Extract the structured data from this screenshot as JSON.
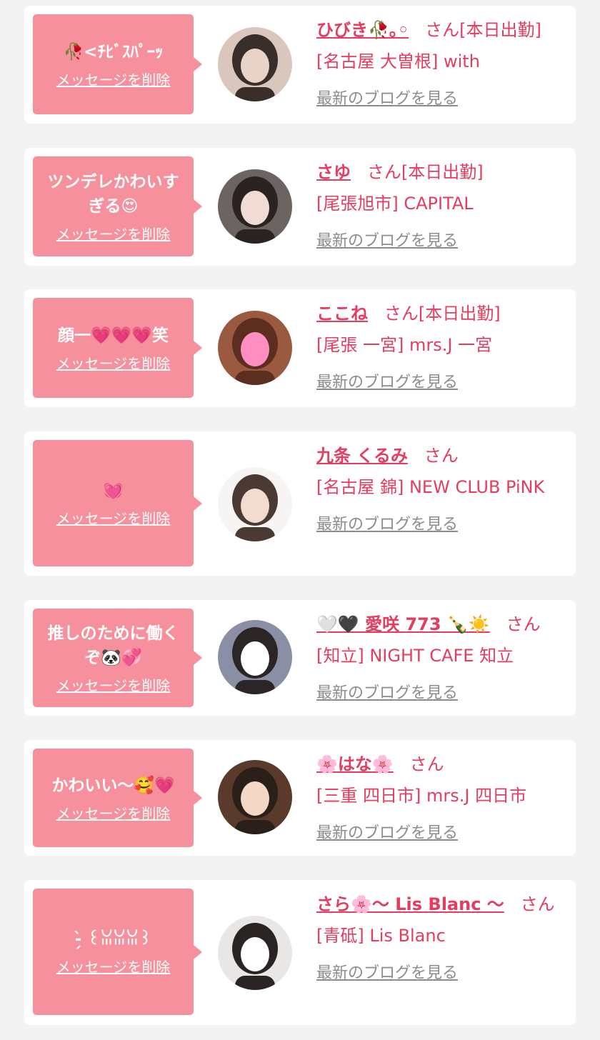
{
  "cards": [
    {
      "message": "🥀<ﾁﾋﾞｽﾊﾟｰｯ",
      "delete_label": "メッセージを削除",
      "name": "ひびき🥀｡◦",
      "san": "さん",
      "status": "[本日出勤]",
      "shop": "[名古屋 大曽根] with",
      "blog_label": "最新のブログを見る",
      "avatar_colors": [
        "#d9c7bd",
        "#3a2e2b",
        "#e8d3c8"
      ]
    },
    {
      "message": "ツンデレかわいすぎる😍",
      "delete_label": "メッセージを削除",
      "name": "さゆ",
      "san": "さん",
      "status": "[本日出勤]",
      "shop": "[尾張旭市] CAPITAL",
      "blog_label": "最新のブログを見る",
      "avatar_colors": [
        "#6b6460",
        "#2a2322",
        "#f0dcd4"
      ]
    },
    {
      "message": "顔一💗💗💗笑",
      "delete_label": "メッセージを削除",
      "name": "ここね",
      "san": "さん",
      "status": "[本日出勤]",
      "shop": "[尾張 一宮] mrs.J 一宮",
      "blog_label": "最新のブログを見る",
      "avatar_colors": [
        "#9a5a3f",
        "#5c2e20",
        "#ff8fc0"
      ]
    },
    {
      "message": "💓",
      "delete_label": "メッセージを削除",
      "name": "九条 くるみ",
      "san": "さん",
      "status": "",
      "shop": "[名古屋 錦] NEW CLUB PiNK",
      "blog_label": "最新のブログを見る",
      "avatar_colors": [
        "#f7f5f3",
        "#4a3a33",
        "#f2dccf"
      ]
    },
    {
      "message": "推しのために働くぞ🐼💞",
      "delete_label": "メッセージを削除",
      "name": "🤍🖤 愛咲 773 🍾☀️",
      "san": "さん",
      "status": "",
      "shop": "[知立] NIGHT CAFE 知立",
      "blog_label": "最新のブログを見る",
      "avatar_colors": [
        "#8a8fa6",
        "#2b2625",
        "#ffffff"
      ]
    },
    {
      "message": "かわいい〜🥰💗",
      "delete_label": "メッセージを削除",
      "name": "🌸はな🌸",
      "san": "さん",
      "status": "",
      "shop": "[三重 四日市] mrs.J 四日市",
      "blog_label": "最新のブログを見る",
      "avatar_colors": [
        "#5a3a2a",
        "#2b1f1a",
        "#f4d8c6"
      ]
    },
    {
      "message": "-̗̀ ꒰ꈍꈍꈍ꒱",
      "delete_label": "メッセージを削除",
      "name": "さら🌸〜 Lis Blanc 〜",
      "san": "さん",
      "status": "",
      "shop": "[青砥] Lis Blanc",
      "blog_label": "最新のブログを見る",
      "avatar_colors": [
        "#e9e7e6",
        "#2a2424",
        "#ffffff"
      ]
    }
  ]
}
